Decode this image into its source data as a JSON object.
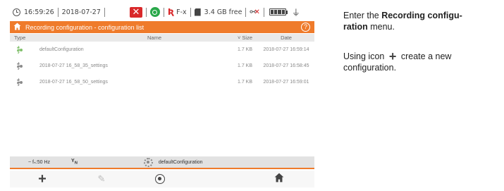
{
  "statusbar": {
    "time": "16:59:26",
    "date": "2018-07-27",
    "clamp_label": "F-x",
    "memory_free": "3.4 GB free"
  },
  "titlebar": {
    "title": "Recording configuration - configuration list",
    "help": "?"
  },
  "table": {
    "headers": {
      "type": "Type",
      "name": "Name",
      "size": "Size",
      "date": "Date"
    },
    "rows": [
      {
        "name": "defaultConfiguration",
        "size": "1.7 KB",
        "date": "2018-07-27 16:59:14",
        "icon": "default-config-gear-icon"
      },
      {
        "name": "2018-07-27 16_58_35_settings",
        "size": "1.7 KB",
        "date": "2018-07-27 16:58:45",
        "icon": "config-gear-icon"
      },
      {
        "name": "2018-07-27 16_58_50_settings",
        "size": "1.7 KB",
        "date": "2018-07-27 16:59:01",
        "icon": "config-gear-icon"
      }
    ]
  },
  "infobar": {
    "frequency": "fₙ:50 Hz",
    "network": "N",
    "active_config": "defaultConfiguration"
  },
  "toolbar": {
    "plus_icon": "+",
    "edit_icon": "✎",
    "home_icon": "⌂"
  },
  "instructions": {
    "p1_prefix": "Enter the ",
    "p1_bold_a": "Recording configu-",
    "p1_bold_b": "ration",
    "p1_suffix": " menu.",
    "p2_prefix": "Using icon",
    "p2_icon": "+",
    "p2_suffix": "create a new configuration."
  }
}
